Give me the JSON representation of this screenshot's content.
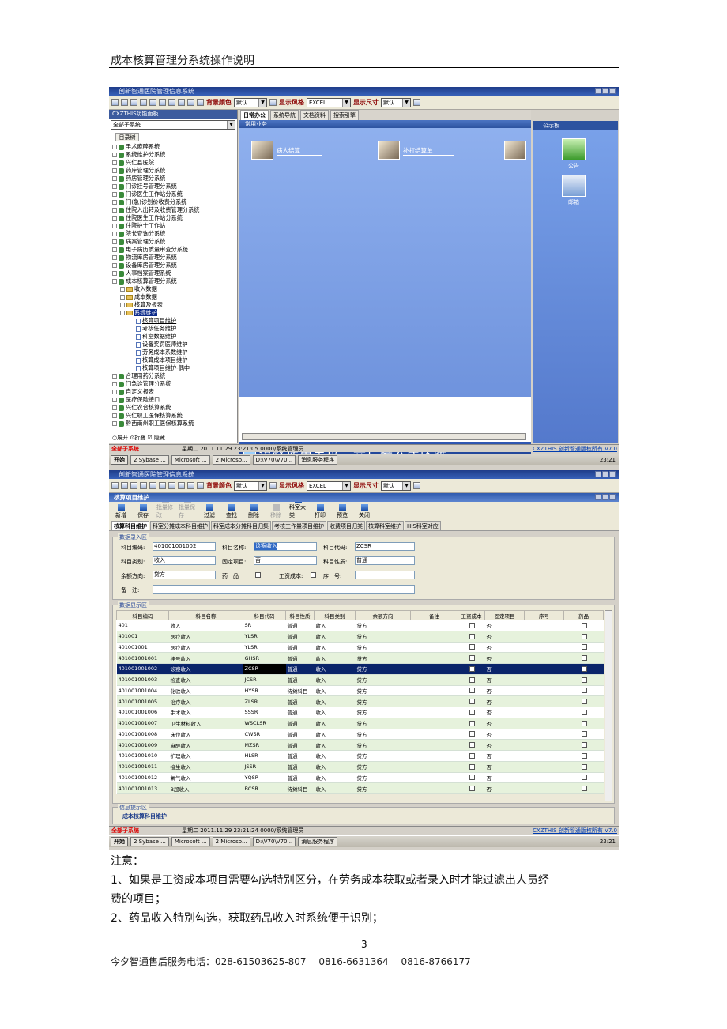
{
  "header": {
    "title": "成本核算管理分系统操作说明"
  },
  "screen1": {
    "window_title": "创新智通医院管理信息系统",
    "toolbar": {
      "bg_label": "背景颜色",
      "bg_value": "默认",
      "style_label": "显示风格",
      "style_value": "EXCEL",
      "size_label": "显示尺寸",
      "size_value": "默认"
    },
    "left_panel": {
      "title": "CXZTHIS功能面板",
      "dropdown": "全部子系统",
      "tree_tab": "目录树",
      "top_nodes": [
        "手术麻醉系统",
        "系统维护分系统",
        "兴仁县医院",
        "药库管理分系统",
        "药房管理分系统",
        "门诊挂号管理分系统",
        "门诊医生工作站分系统",
        "门(急)诊划价收费分系统",
        "住院入出转及收费管理分系统",
        "住院医生工作站分系统",
        "住院护士工作站",
        "院长查询分系统",
        "病案管理分系统",
        "电子病历质量审查分系统",
        "物流库房管理分系统",
        "设备库房管理分系统",
        "人事档案管理系统",
        "成本核算管理分系统"
      ],
      "sub_nodes": [
        "收入数据",
        "成本数据",
        "核算及报表"
      ],
      "maint_node": "系统维护",
      "maint_children": [
        "核算项目维护",
        "考核任务维护",
        "科室数据维护",
        "设备奖罚医师维护",
        "劳务成本系数维护",
        "核算成本项目维护",
        "核算项目维护-偶中"
      ],
      "bottom_nodes": [
        "合理用药分系统",
        "门急诊管理分系统",
        "自定义报表",
        "医疗保险接口",
        "兴仁农合核算系统",
        "兴仁职工医保核算系统",
        "黔西南州职工医保核算系统"
      ],
      "footer": "○展开 ⊙折叠 ☑ 隐藏"
    },
    "tabs": [
      "日常办公",
      "系统导航",
      "文档资料",
      "搜索引擎"
    ],
    "section_title": "常用业务",
    "biz_items": [
      "病人结算",
      "补打结算单"
    ],
    "authorized": "授权使用单位：兴仁县人民医院",
    "notice_panel": {
      "title": "公示板",
      "items": [
        "公告",
        "邮箱"
      ]
    },
    "status": {
      "left": "全部子系统",
      "mid": "星期二 2011.11.29 23:21:05  0000/系统管理员",
      "right": "CXZTHIS 创新智通版权所有 V7.0"
    },
    "taskbar": {
      "start": "开始",
      "items": [
        "2 Sybase ...",
        "Microsoft ...",
        "2 Microso...",
        "D:\\V70\\V70...",
        "消息服务程序"
      ],
      "time": "23:21"
    }
  },
  "screen2": {
    "window_title": "创新智通医院管理信息系统",
    "inner_title": "核算项目维护",
    "buttons": [
      "新增",
      "保存",
      "批量修改",
      "批量保存",
      "过滤",
      "查找",
      "删除",
      "移除",
      "科室大类",
      "打印",
      "预览",
      "关闭"
    ],
    "tabs": [
      "核算科目维护",
      "科室分摊成本科目维护",
      "科室成本分摊科目归集",
      "考核工作量项目维护",
      "收费项目归类",
      "核算科室维护",
      "HIS科室对应"
    ],
    "entry": {
      "legend": "数据录入区",
      "code_label": "科目编码:",
      "code_value": "401001001002",
      "name_label": "科目名称:",
      "name_value": "诊察收入",
      "abbr_label": "科目代码:",
      "abbr_value": "ZCSR",
      "type_label": "科目类别:",
      "type_value": "收入",
      "fixed_label": "固定项目:",
      "fixed_value": "否",
      "nature_label": "科目性质:",
      "nature_value": "普通",
      "dir_label": "余额方向:",
      "dir_value": "贷方",
      "drug_label": "药　品",
      "wage_label": "工资成本:",
      "seq_label": "序　号:",
      "remark_label": "备　注:"
    },
    "grid": {
      "legend": "数据显示区",
      "headers": [
        "科目编码",
        "科目名称",
        "科目代码",
        "科目性质",
        "科目类别",
        "余额方向",
        "备注",
        "工资成本",
        "固定项目",
        "序号",
        "药品"
      ],
      "rows": [
        [
          "401",
          "收入",
          "SR",
          "普通",
          "收入",
          "贷方",
          "",
          "",
          "否",
          "",
          ""
        ],
        [
          "401001",
          "医疗收入",
          "YLSR",
          "普通",
          "收入",
          "贷方",
          "",
          "",
          "否",
          "",
          ""
        ],
        [
          "401001001",
          "医疗收入",
          "YLSR",
          "普通",
          "收入",
          "贷方",
          "",
          "",
          "否",
          "",
          ""
        ],
        [
          "401001001001",
          "挂号收入",
          "GHSR",
          "普通",
          "收入",
          "贷方",
          "",
          "",
          "否",
          "",
          ""
        ],
        [
          "401001001002",
          "诊察收入",
          "ZCSR",
          "普通",
          "收入",
          "贷方",
          "",
          "",
          "否",
          "",
          ""
        ],
        [
          "401001001003",
          "检查收入",
          "JCSR",
          "普通",
          "收入",
          "贷方",
          "",
          "",
          "否",
          "",
          ""
        ],
        [
          "401001001004",
          "化验收入",
          "HYSR",
          "待摊科目",
          "收入",
          "贷方",
          "",
          "",
          "否",
          "",
          ""
        ],
        [
          "401001001005",
          "治疗收入",
          "ZLSR",
          "普通",
          "收入",
          "贷方",
          "",
          "",
          "否",
          "",
          ""
        ],
        [
          "401001001006",
          "手术收入",
          "SSSR",
          "普通",
          "收入",
          "贷方",
          "",
          "",
          "否",
          "",
          ""
        ],
        [
          "401001001007",
          "卫生材料收入",
          "WSCLSR",
          "普通",
          "收入",
          "贷方",
          "",
          "",
          "否",
          "",
          ""
        ],
        [
          "401001001008",
          "床位收入",
          "CWSR",
          "普通",
          "收入",
          "贷方",
          "",
          "",
          "否",
          "",
          ""
        ],
        [
          "401001001009",
          "麻醉收入",
          "MZSR",
          "普通",
          "收入",
          "贷方",
          "",
          "",
          "否",
          "",
          ""
        ],
        [
          "401001001010",
          "护理收入",
          "HLSR",
          "普通",
          "收入",
          "贷方",
          "",
          "",
          "否",
          "",
          ""
        ],
        [
          "401001001011",
          "接生收入",
          "JSSR",
          "普通",
          "收入",
          "贷方",
          "",
          "",
          "否",
          "",
          ""
        ],
        [
          "401001001012",
          "氧气收入",
          "YQSR",
          "普通",
          "收入",
          "贷方",
          "",
          "",
          "否",
          "",
          ""
        ],
        [
          "401001001013",
          "B超收入",
          "BCSR",
          "待摊科目",
          "收入",
          "贷方",
          "",
          "",
          "否",
          "",
          ""
        ]
      ]
    },
    "info": {
      "legend": "信息提示区",
      "text": "成本核算科目维护"
    },
    "status": {
      "left": "全部子系统",
      "mid": "星期二 2011.11.29 23:21:24  0000/系统管理员",
      "right": "CXZTHIS 创新智通版权所有 V7.0"
    },
    "taskbar": {
      "start": "开始",
      "items": [
        "2 Sybase ...",
        "Microsoft ...",
        "2 Microso...",
        "D:\\V70\\V70...",
        "消息服务程序"
      ],
      "time": "23:21"
    }
  },
  "notes": {
    "title": "注意：",
    "item1": "1、如果是工资成本项目需要勾选特别区分，在劳务成本获取或者录入时才能过滤出人员经",
    "item1b": "费的项目；",
    "item2": "2、药品收入特别勾选，获取药品收入时系统便于识别；"
  },
  "page_number": "3",
  "footer": "今夕智通售后服务电话：028-61503625-807　 0816-6631364 　0816-8766177"
}
